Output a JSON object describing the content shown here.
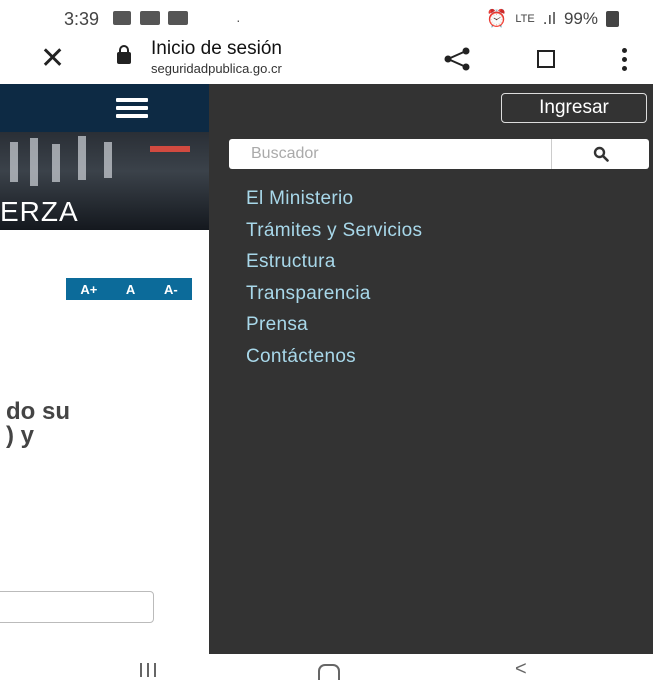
{
  "status_bar": {
    "time": "3:39",
    "network": "LTE",
    "battery": "99%"
  },
  "browser": {
    "page_title": "Inicio de sesión",
    "url": "seguridadpublica.go.cr"
  },
  "page": {
    "hero_text": "ERZA",
    "font_controls": [
      "A+",
      "A",
      "A-"
    ],
    "partial_text_line1": "do su",
    "partial_text_line2": ") y",
    "header_color": "#0d2a44"
  },
  "menu": {
    "login_label": "Ingresar",
    "search_placeholder": "Buscador",
    "items": [
      "El Ministerio",
      "Trámites y Servicios",
      "Estructura",
      "Transparencia",
      "Prensa",
      "Contáctenos"
    ],
    "link_color": "#a8d8ea",
    "panel_color": "#333333"
  }
}
